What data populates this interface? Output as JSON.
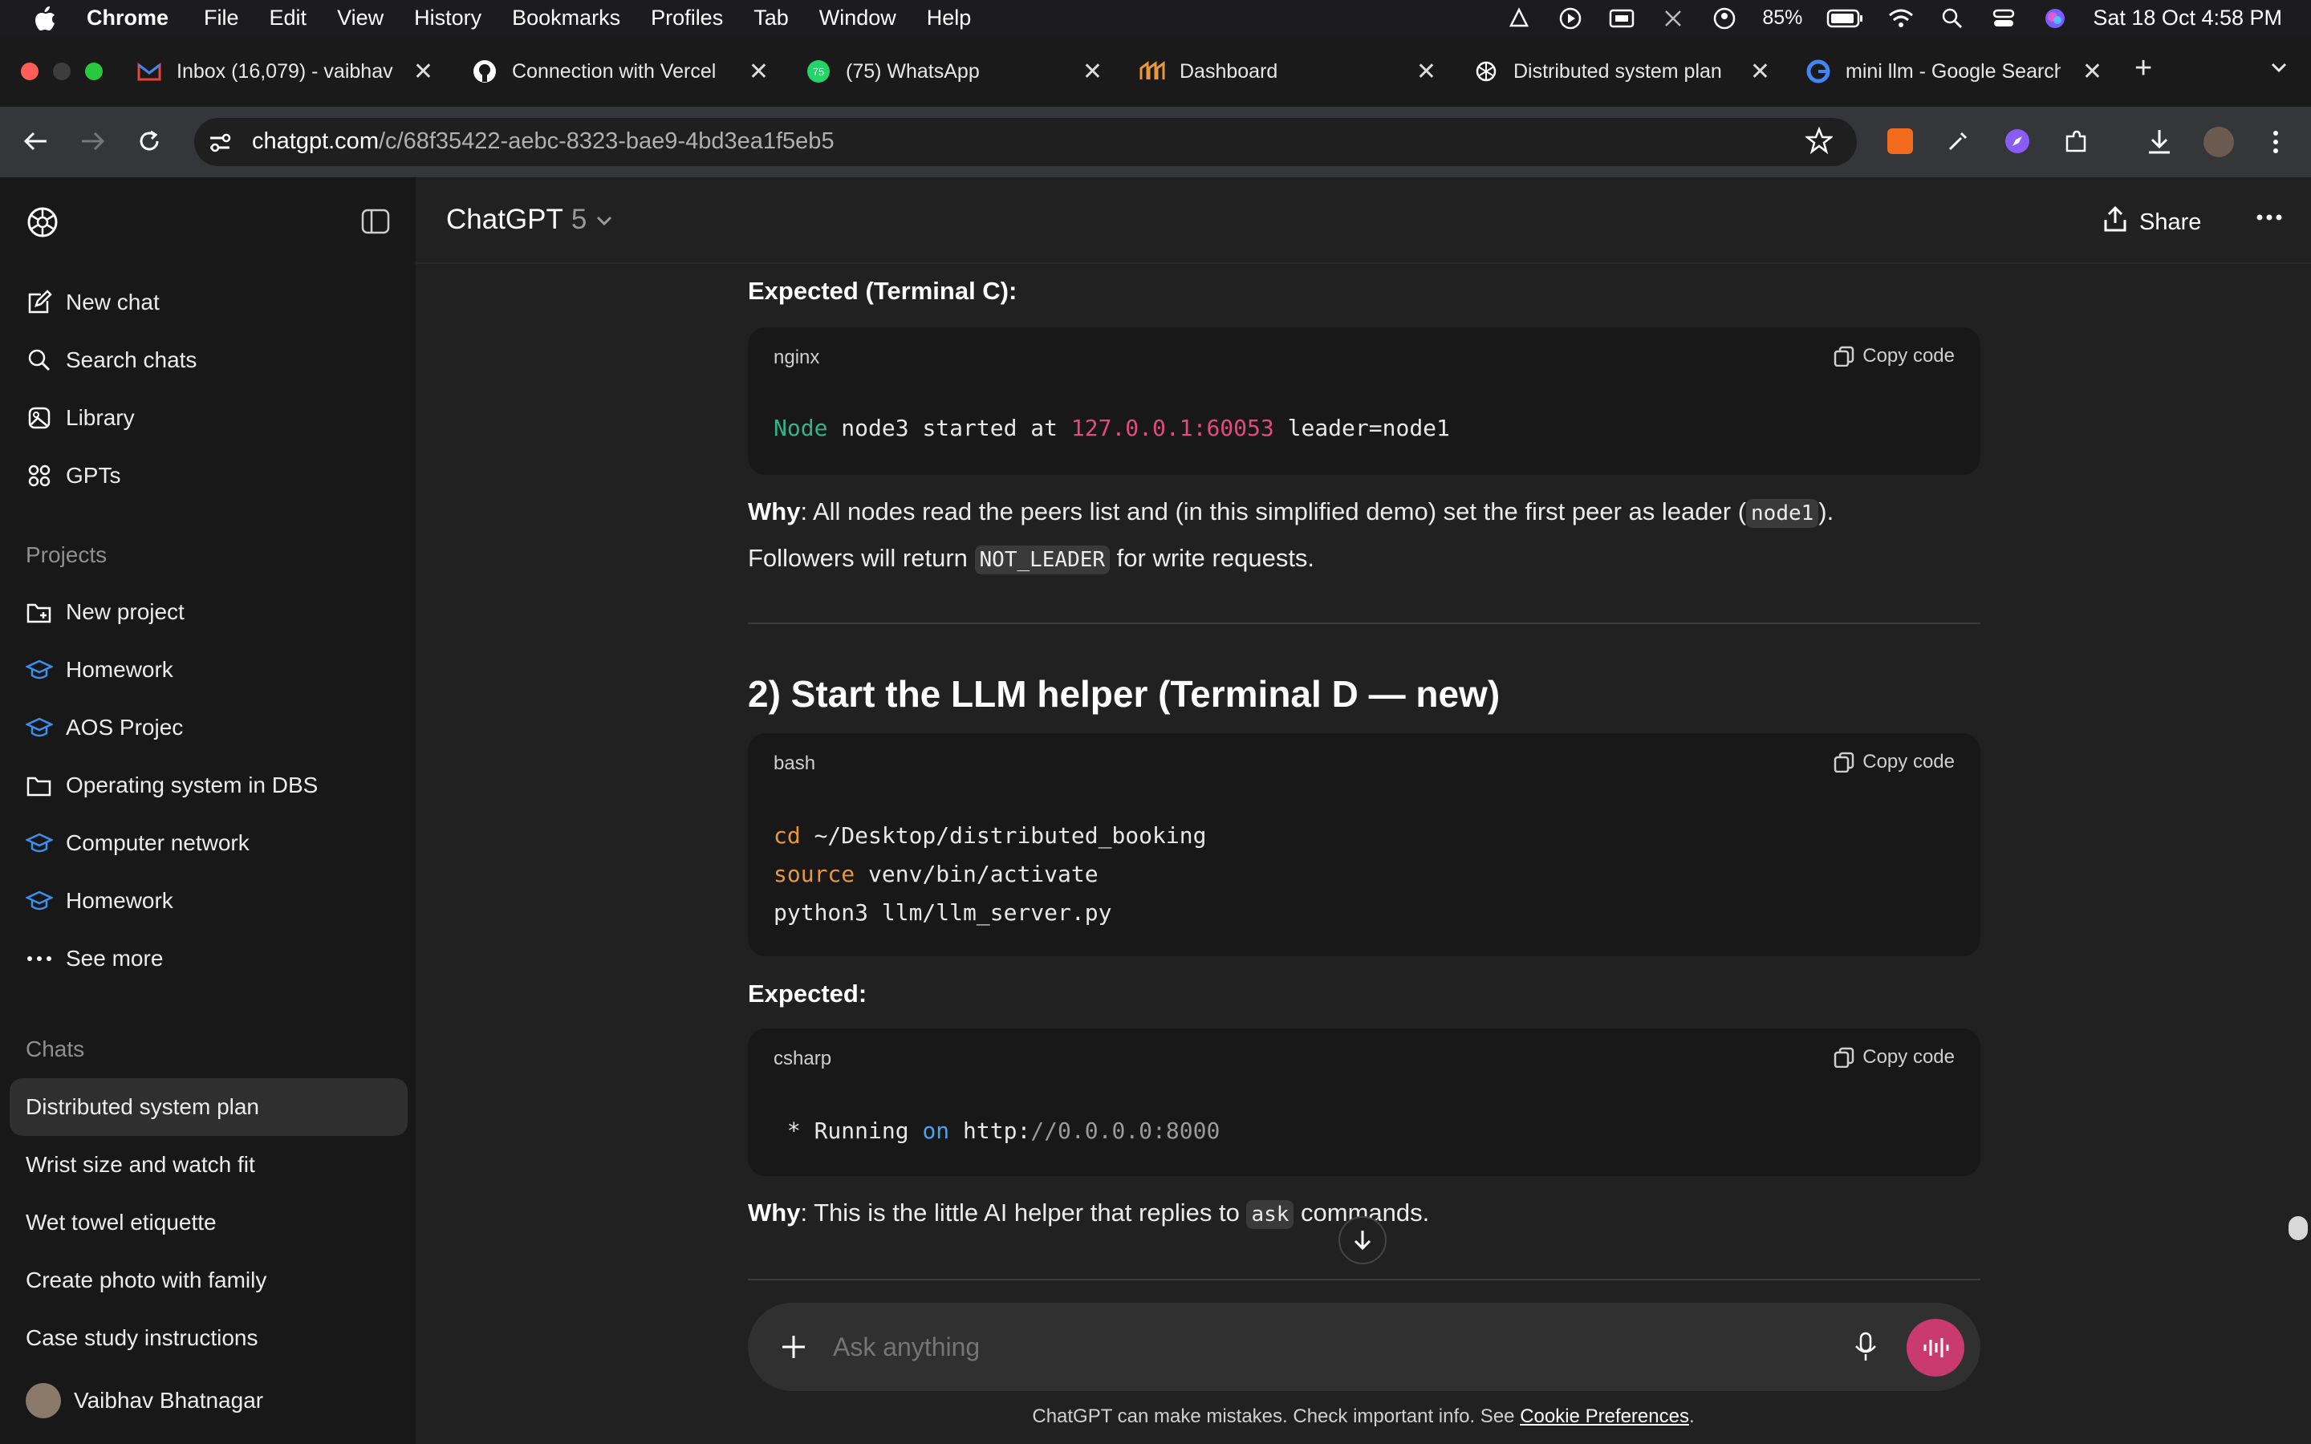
{
  "menubar": {
    "app": "Chrome",
    "items": [
      "File",
      "Edit",
      "View",
      "History",
      "Bookmarks",
      "Profiles",
      "Tab",
      "Window",
      "Help"
    ],
    "battery": "85%",
    "datetime": "Sat 18 Oct  4:58 PM"
  },
  "tabs": [
    {
      "title": "Inbox (16,079) - vaibhav",
      "icon": "gmail-icon"
    },
    {
      "title": "Connection with Vercel",
      "icon": "github-icon"
    },
    {
      "title": "(75) WhatsApp",
      "icon": "whatsapp-icon"
    },
    {
      "title": "Dashboard",
      "icon": "dashboard-icon"
    },
    {
      "title": "Distributed system plan",
      "icon": "openai-icon"
    },
    {
      "title": "mini llm - Google Search",
      "icon": "google-icon"
    }
  ],
  "address": {
    "host": "chatgpt.com",
    "path": "/c/68f35422-aebc-8323-bae9-4bd3ea1f5eb5"
  },
  "sidebar": {
    "nav": [
      {
        "label": "New chat",
        "icon": "new-chat-icon"
      },
      {
        "label": "Search chats",
        "icon": "search-icon"
      },
      {
        "label": "Library",
        "icon": "library-icon"
      },
      {
        "label": "GPTs",
        "icon": "gpts-icon"
      }
    ],
    "projects_heading": "Projects",
    "projects": [
      {
        "label": "New project",
        "icon": "new-folder-icon"
      },
      {
        "label": "Homework",
        "icon": "graduation-cap-icon"
      },
      {
        "label": "AOS Projec",
        "icon": "graduation-cap-icon"
      },
      {
        "label": "Operating system in DBS",
        "icon": "folder-icon"
      },
      {
        "label": "Computer network",
        "icon": "graduation-cap-icon"
      },
      {
        "label": "Homework",
        "icon": "graduation-cap-icon"
      },
      {
        "label": "See more",
        "icon": "ellipsis-icon"
      }
    ],
    "chats_heading": "Chats",
    "chats": [
      "Distributed system plan",
      "Wrist size and watch fit",
      "Wet towel etiquette",
      "Create photo with family",
      "Case study instructions"
    ],
    "user": "Vaibhav Bhatnagar"
  },
  "header": {
    "model": "ChatGPT",
    "version": "5",
    "share": "Share"
  },
  "content": {
    "expected_c": "Expected (Terminal C):",
    "block1": {
      "lang": "nginx",
      "copy": "Copy code",
      "w1": "Node",
      "w2": " node3 started at ",
      "w3": "127.0.0.1:60053",
      "w4": " leader=node1"
    },
    "why1_label": "Why",
    "why1_a": ": All nodes read the peers list and (in this simplified demo) set the first peer as leader (",
    "why1_code": "node1",
    "why1_b": ").",
    "why1_c": "Followers will return ",
    "why1_code2": "NOT_LEADER",
    "why1_d": " for write requests.",
    "section2": "2) Start the LLM helper (Terminal D — new)",
    "block2": {
      "lang": "bash",
      "copy": "Copy code",
      "l1k": "cd",
      "l1r": " ~/Desktop/distributed_booking",
      "l2k": "source",
      "l2r": " venv/bin/activate",
      "l3": "python3 llm/llm_server.py"
    },
    "expected2": "Expected:",
    "block3": {
      "lang": "csharp",
      "copy": "Copy code",
      "a": " * Running ",
      "b": "on",
      "c": " http:",
      "d": "//0.0.0.0:8000"
    },
    "why2_label": "Why",
    "why2_a": ": This is the little AI helper that replies to ",
    "why2_code": "ask",
    "why2_b": " commands."
  },
  "composer": {
    "placeholder": "Ask anything"
  },
  "footer": {
    "text": "ChatGPT can make mistakes. Check important info. See ",
    "link": "Cookie Preferences",
    "end": "."
  }
}
